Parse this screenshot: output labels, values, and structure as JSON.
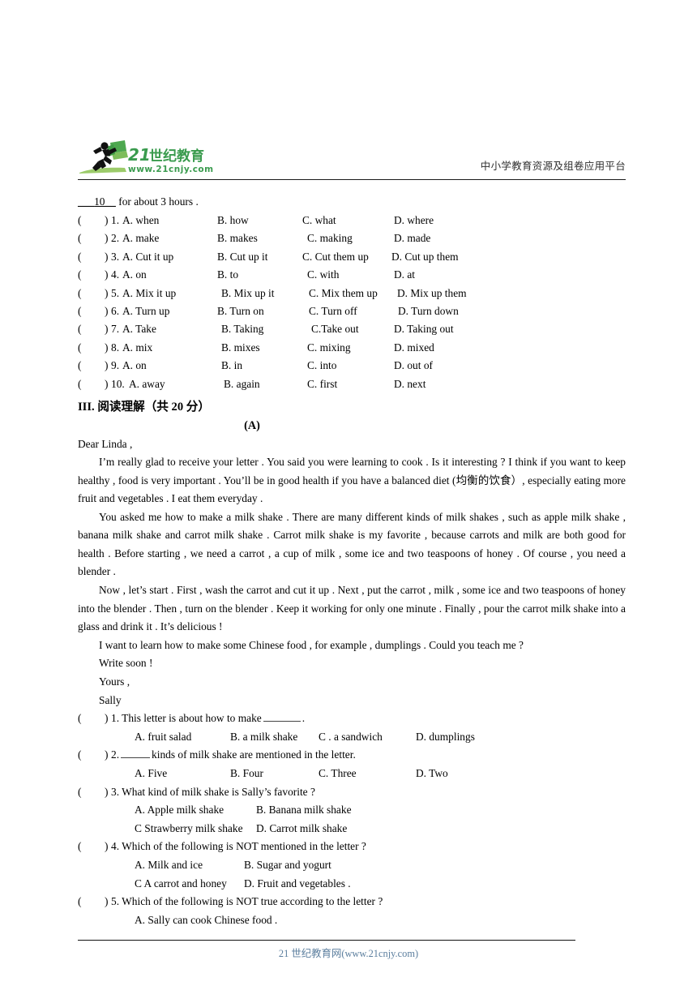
{
  "header": {
    "logo_brand": "21世纪教育",
    "logo_url": "www.21cnjy.com",
    "tagline": "中小学教育资源及组卷应用平台",
    "brand_green": "#3a9b4e",
    "brand_light_green": "#8cc63f"
  },
  "cloze": {
    "lead_blank": "10",
    "lead_prefix": "___",
    "lead_suffix": "__",
    "lead_text": "for about 3 hours .",
    "paren_open": "(",
    "paren_close": ")",
    "items": [
      {
        "num": "1.",
        "a": "A. when",
        "b": "B. how",
        "c": "C. what",
        "d": "D. where"
      },
      {
        "num": "2.",
        "a": "A. make",
        "b": "B. makes",
        "c": "C. making",
        "d": "D. made"
      },
      {
        "num": "3.",
        "a": "A. Cut it up",
        "b": "B. Cut up it",
        "c": "C. Cut them up",
        "d": "D. Cut up them"
      },
      {
        "num": "4.",
        "a": "A. on",
        "b": "B. to",
        "c": "C. with",
        "d": "D. at"
      },
      {
        "num": "5.",
        "a": "A. Mix it up",
        "b": "B. Mix up it",
        "c": "C. Mix them up",
        "d": "D. Mix up them"
      },
      {
        "num": "6.",
        "a": "A. Turn up",
        "b": "B. Turn on",
        "c": "C. Turn off",
        "d": "D. Turn down"
      },
      {
        "num": "7.",
        "a": "A. Take",
        "b": "B. Taking",
        "c": "C.Take out",
        "d": "D. Taking out"
      },
      {
        "num": "8.",
        "a": "A. mix",
        "b": "B. mixes",
        "c": "C. mixing",
        "d": "D. mixed"
      },
      {
        "num": "9.",
        "a": "A. on",
        "b": "B. in",
        "c": "C. into",
        "d": "D. out of"
      },
      {
        "num": "10.",
        "a": "A. away",
        "b": "B. again",
        "c": "C. first",
        "d": "D. next"
      }
    ]
  },
  "section": {
    "heading": "III.  阅读理解（共 20 分）",
    "passage_label": "(A)"
  },
  "letter": {
    "salutation": "Dear Linda ,",
    "p1": "I’m really glad to receive your letter . You said you were learning to cook . Is it interesting ? I think if you want to keep healthy , food is very important . You’ll be in good health if you have a balanced diet (均衡的饮食）, especially eating more fruit and vegetables . I eat them everyday .",
    "p2": "You asked me how to make a milk shake . There are many different kinds of milk shakes , such as apple milk shake , banana milk shake and carrot milk shake . Carrot milk shake is my favorite , because carrots and milk are both good for health . Before starting , we need a carrot , a cup of milk , some ice and two teaspoons of honey . Of course , you need a blender .",
    "p3": "Now , let’s start . First , wash the carrot and cut it up . Next , put the carrot , milk , some ice and two teaspoons of honey into the blender . Then , turn on the blender . Keep it working for only one minute . Finally , pour the carrot milk shake into a glass and drink it . It’s delicious !",
    "p4": "I want to learn how to make some Chinese food , for example , dumplings . Could you teach me ?",
    "closing1": "Write soon !",
    "closing2": "Yours ,",
    "signature": "Sally"
  },
  "reading_questions": {
    "paren_open": "(",
    "paren_close": ")",
    "q1": {
      "num": "1.",
      "stem_before": "This letter is about how to make",
      "stem_after": ".",
      "a": "A.  fruit salad",
      "b": "B. a milk shake",
      "c": "C . a sandwich",
      "d": "D. dumplings"
    },
    "q2": {
      "num": "2.",
      "stem_before": "",
      "stem_after": "kinds of milk shake are mentioned in the letter.",
      "a": "A.  Five",
      "b": "B. Four",
      "c": "C. Three",
      "d": "D. Two"
    },
    "q3": {
      "num": "3.",
      "stem": "What kind of milk shake is Sally’s favorite ?",
      "a": "A.  Apple milk shake",
      "b": "B. Banana milk shake",
      "c": "C    Strawberry milk shake",
      "d": "D. Carrot milk shake"
    },
    "q4": {
      "num": "4.",
      "stem": "Which of the following is NOT mentioned in the letter ?",
      "a": "A.  Milk and ice",
      "b": "B. Sugar and yogurt",
      "c": "C A carrot and honey",
      "d": "D. Fruit and vegetables ."
    },
    "q5": {
      "num": "5.",
      "stem": "Which of the following is NOT true according to the letter ?",
      "a": "A.  Sally can cook Chinese food ."
    }
  },
  "footer": {
    "text": "21 世纪教育网(www.21cnjy.com)",
    "color": "#5b7e9e"
  }
}
